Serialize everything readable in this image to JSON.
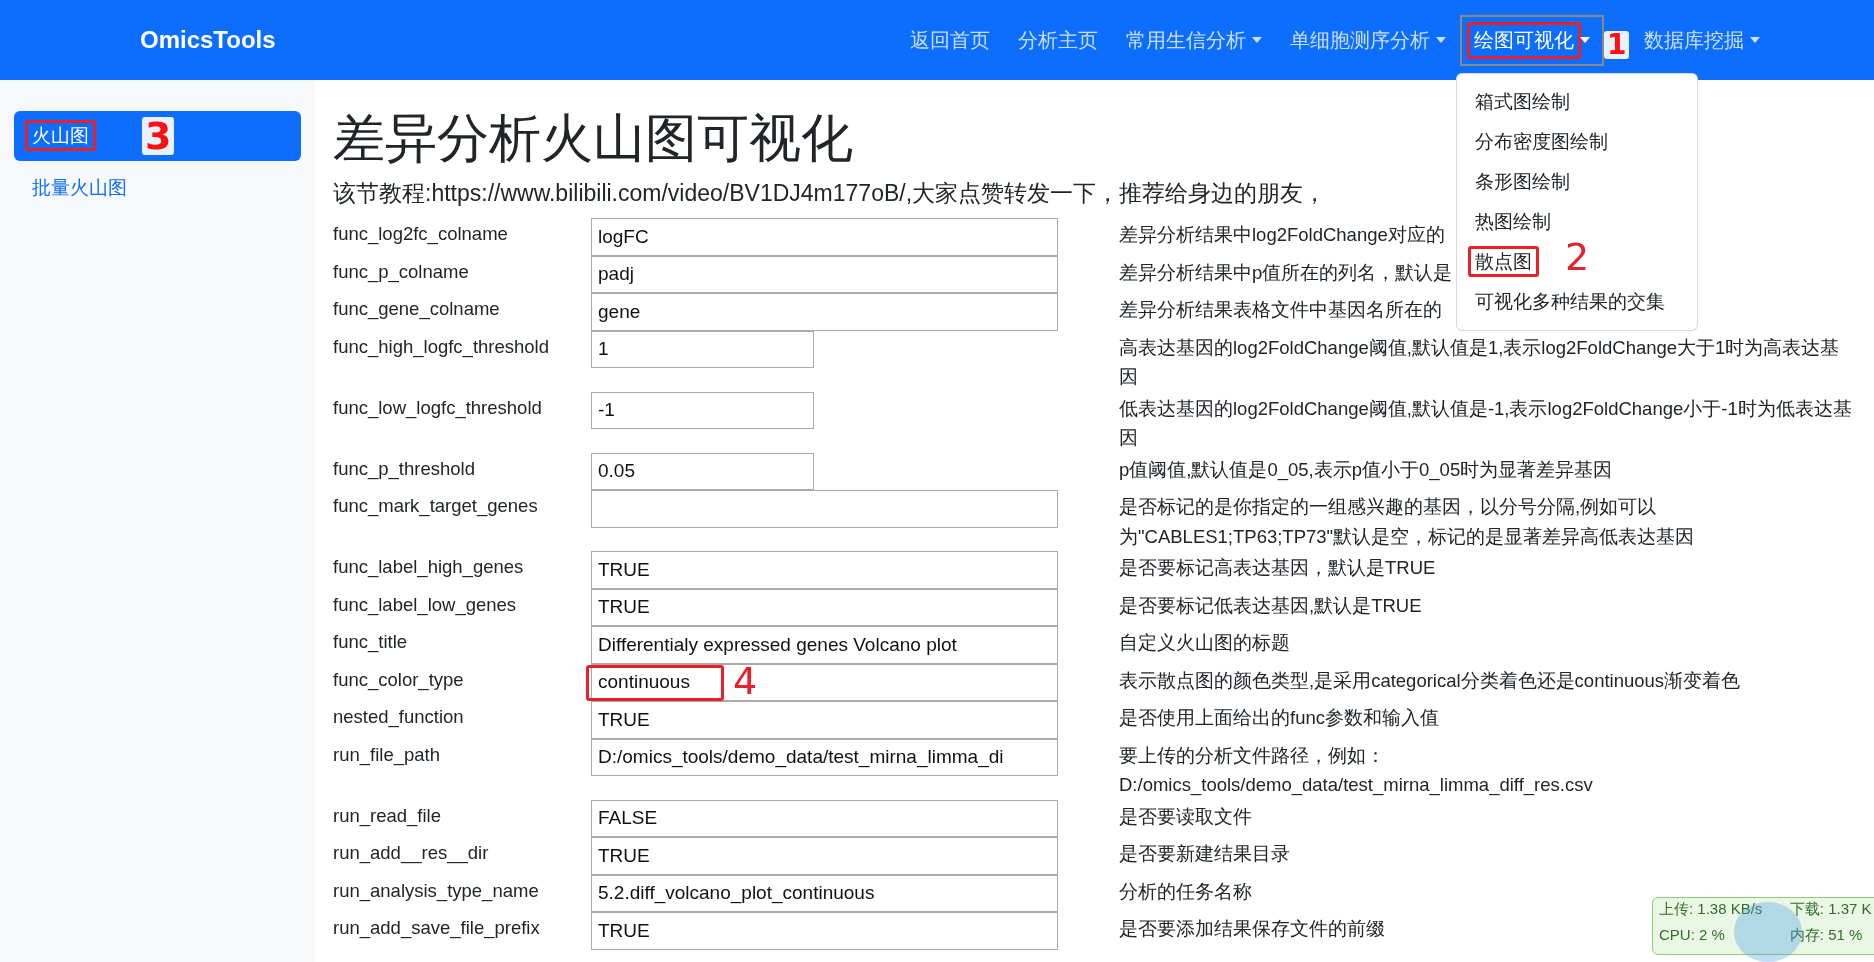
{
  "navbar": {
    "brand": "OmicsTools",
    "items": [
      {
        "label": "返回首页",
        "dropdown": false,
        "selected": false
      },
      {
        "label": "分析主页",
        "dropdown": false,
        "selected": false
      },
      {
        "label": "常用生信分析",
        "dropdown": true,
        "selected": false
      },
      {
        "label": "单细胞测序分析",
        "dropdown": true,
        "selected": false
      },
      {
        "label": "绘图可视化",
        "dropdown": true,
        "selected": true,
        "annotation": "1",
        "menu": [
          {
            "label": "箱式图绘制"
          },
          {
            "label": "分布密度图绘制"
          },
          {
            "label": "条形图绘制"
          },
          {
            "label": "热图绘制"
          },
          {
            "label": "散点图",
            "annotation": "2"
          },
          {
            "label": "可视化多种结果的交集"
          }
        ]
      },
      {
        "label": "数据库挖掘",
        "dropdown": true,
        "selected": false
      }
    ]
  },
  "sidebar": {
    "items": [
      {
        "label": "火山图",
        "selected": true,
        "annotation": "3"
      },
      {
        "label": "批量火山图",
        "selected": false
      }
    ]
  },
  "page": {
    "title": "差异分析火山图可视化",
    "subtitle": "该节教程:https://www.bilibili.com/video/BV1DJ4m177oB/,大家点赞转发一下，推荐给身边的朋友，"
  },
  "params": [
    {
      "name": "func_log2fc_colname",
      "value": "logFC",
      "kind": "long",
      "description": "差异分析结果中log2FoldChange对应的"
    },
    {
      "name": "func_p_colname",
      "value": "padj",
      "kind": "long",
      "description": "差异分析结果中p值所在的列名，默认是"
    },
    {
      "name": "func_gene_colname",
      "value": "gene",
      "kind": "long",
      "description": "差异分析结果表格文件中基因名所在的"
    },
    {
      "name": "func_high_logfc_threshold",
      "value": "1",
      "kind": "short",
      "description": "高表达基因的log2FoldChange阈值,默认值是1,表示log2FoldChange大于1时为高表达基因"
    },
    {
      "name": "func_low_logfc_threshold",
      "value": "-1",
      "kind": "short",
      "description": "低表达基因的log2FoldChange阈值,默认值是-1,表示log2FoldChange小于-1时为低表达基因"
    },
    {
      "name": "func_p_threshold",
      "value": "0.05",
      "kind": "short",
      "description": "p值阈值,默认值是0_05,表示p值小于0_05时为显著差异基因"
    },
    {
      "name": "func_mark_target_genes",
      "kind": "long",
      "description": "是否标记的是你指定的一组感兴趣的基因，以分号分隔,例如可以为\"CABLES1;TP63;TP73\"默认是空，标记的是显著差异高低表达基因"
    },
    {
      "name": "func_label_high_genes",
      "value": "TRUE",
      "kind": "long",
      "description": "是否要标记高表达基因，默认是TRUE"
    },
    {
      "name": "func_label_low_genes",
      "value": "TRUE",
      "kind": "long",
      "description": "是否要标记低表达基因,默认是TRUE"
    },
    {
      "name": "func_title",
      "value": "Differentialy expressed genes Volcano plot",
      "kind": "long",
      "description": "自定义火山图的标题"
    },
    {
      "name": "func_color_type",
      "value": "continuous",
      "kind": "long",
      "annotation": "4",
      "description": "表示散点图的颜色类型,是采用categorical分类着色还是continuous渐变着色"
    },
    {
      "name": "nested_function",
      "value": "TRUE",
      "kind": "long",
      "description": "是否使用上面给出的func参数和输入值"
    },
    {
      "name": "run_file_path",
      "value": "D:/omics_tools/demo_data/test_mirna_limma_di",
      "kind": "long",
      "description": "要上传的分析文件路径，例如：D:/omics_tools/demo_data/test_mirna_limma_diff_res.csv"
    },
    {
      "name": "run_read_file",
      "value": "FALSE",
      "kind": "long",
      "description": "是否要读取文件"
    },
    {
      "name": "run_add__res__dir",
      "value": "TRUE",
      "kind": "long",
      "description": "是否要新建结果目录"
    },
    {
      "name": "run_analysis_type_name",
      "value": "5.2.diff_volcano_plot_continuous",
      "kind": "long",
      "description": "分析的任务名称"
    },
    {
      "name": "run_add_save_file_prefix",
      "value": "TRUE",
      "kind": "long",
      "description": "是否要添加结果保存文件的前缀"
    }
  ],
  "net_monitor": {
    "upload": "上传: 1.38 KB/s",
    "download": "下载: 1.37 K",
    "cpu": "CPU: 2 %",
    "memory": "内存: 51 %"
  }
}
